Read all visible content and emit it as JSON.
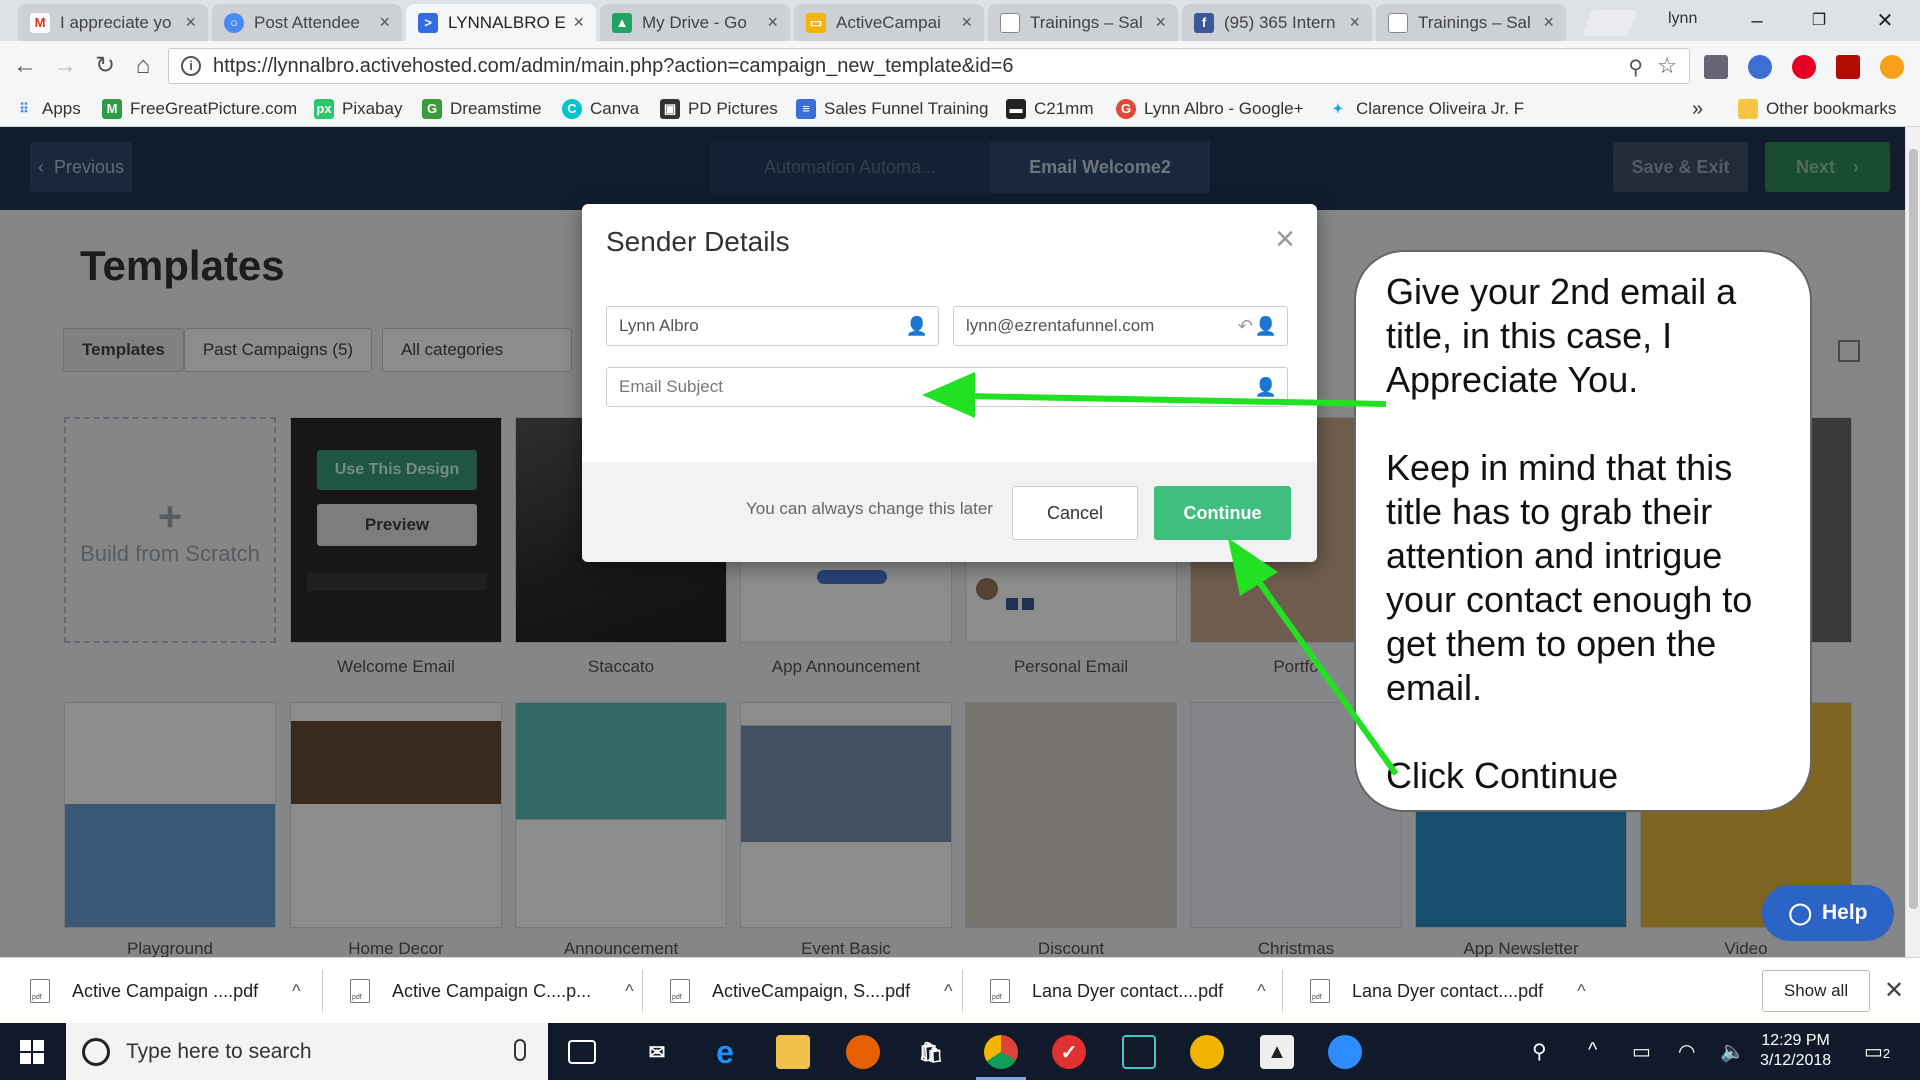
{
  "browser": {
    "tabs": [
      {
        "label": "I appreciate yo",
        "icon": "gmail-icon",
        "color": "#d93025"
      },
      {
        "label": "Post Attendee",
        "icon": "chat-icon",
        "color": "#4a8af4"
      },
      {
        "label": "LYNNALBRO E",
        "icon": "activecampaign-icon",
        "color": "#356ae6"
      },
      {
        "label": "My Drive - Go",
        "icon": "drive-icon",
        "color": "#1fa463"
      },
      {
        "label": "ActiveCampai",
        "icon": "slides-icon",
        "color": "#f4b400"
      },
      {
        "label": "Trainings – Sal",
        "icon": "page-icon",
        "color": "#888888"
      },
      {
        "label": "(95) 365 Intern",
        "icon": "facebook-icon",
        "color": "#3b5998"
      },
      {
        "label": "Trainings – Sal",
        "icon": "page-icon",
        "color": "#888888"
      }
    ],
    "user": "lynn",
    "url": "https://lynnalbro.activehosted.com/admin/main.php?action=campaign_new_template&id=6",
    "bookmarks": [
      {
        "label": "Apps",
        "color": "#4285f4",
        "glyph": "⋮⋮"
      },
      {
        "label": "FreeGreatPicture.com",
        "color": "#2e9e44",
        "glyph": "M"
      },
      {
        "label": "Pixabay",
        "color": "#2ec66b",
        "glyph": "px"
      },
      {
        "label": "Dreamstime",
        "color": "#3a9d3a",
        "glyph": "G"
      },
      {
        "label": "Canva",
        "color": "#00c4cc",
        "glyph": "C"
      },
      {
        "label": "PD Pictures",
        "color": "#333333",
        "glyph": "▣"
      },
      {
        "label": "Sales Funnel Training",
        "color": "#3b6fd6",
        "glyph": "≡"
      },
      {
        "label": "C21mm",
        "color": "#222222",
        "glyph": "▬"
      },
      {
        "label": "Lynn Albro - Google+",
        "color": "#dd4b39",
        "glyph": "G"
      },
      {
        "label": "Clarence Oliveira Jr. F",
        "color": "#1da1f2",
        "glyph": "✦"
      }
    ],
    "more": "»",
    "other_bookmarks": "Other bookmarks"
  },
  "app": {
    "previous": "Previous",
    "steps": [
      "Automation Automa...",
      "Email Welcome2"
    ],
    "save_exit": "Save & Exit",
    "next": "Next",
    "page_title": "Templates",
    "filters": [
      "Templates",
      "Past Campaigns (5)",
      "All categories"
    ],
    "build_from_scratch": "Build from Scratch",
    "use_this_design": "Use This Design",
    "preview": "Preview",
    "templates_row1": [
      "Welcome Email",
      "Staccato",
      "App Announcement",
      "Personal Email",
      "Portfo"
    ],
    "templates_row2": [
      "Playground",
      "Home Decor",
      "Announcement",
      "Event Basic",
      "Discount",
      "Christmas",
      "App Newsletter",
      "Video"
    ],
    "help": "Help"
  },
  "modal": {
    "title": "Sender Details",
    "from_name": "Lynn Albro",
    "from_email": "lynn@ezrentafunnel.com",
    "subject_placeholder": "Email Subject",
    "hint": "You can always change this later",
    "cancel": "Cancel",
    "continue": "Continue"
  },
  "callout": {
    "p1": "Give your 2nd email a title, in this case, I Appreciate You.",
    "p2": "Keep in mind that this title has to grab their attention and intrigue your contact enough to get them to open the email.",
    "p3": "Click Continue",
    "arrow_color": "#22e022"
  },
  "downloads": {
    "items": [
      "Active Campaign ....pdf",
      "Active Campaign C....p...",
      "ActiveCampaign, S....pdf",
      "Lana Dyer contact....pdf",
      "Lana Dyer contact....pdf"
    ],
    "show_all": "Show all"
  },
  "taskbar": {
    "search_placeholder": "Type here to search",
    "time": "12:29 PM",
    "date": "3/12/2018",
    "notifications": "2"
  }
}
